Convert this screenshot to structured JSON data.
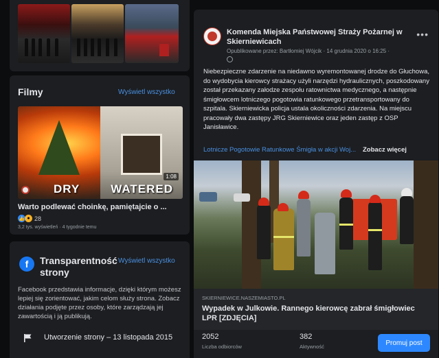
{
  "films": {
    "title": "Filmy",
    "see_all": "Wyświetl wszystko",
    "video": {
      "thumb_left_label": "DRY",
      "thumb_right_label": "WATERED",
      "duration": "1:08",
      "title": "Warto podlewać choinkę, pamiętajcie o ...",
      "reaction_count": "28",
      "meta": "3,2 tys. wyświetleń · 4 tygodnie temu"
    }
  },
  "transparency": {
    "title": "Transparentność strony",
    "see_all": "Wyświetl wszystko",
    "description": "Facebook przedstawia informacje, dzięki którym możesz lepiej się zorientować, jakim celom służy strona. Zobacz działania podjęte przez osoby, które zarządzają jej zawartością i ją publikują.",
    "created": "Utworzenie strony – 13 listopada 2015",
    "icon": "facebook-icon"
  },
  "post": {
    "page_name": "Komenda Miejska Państwowej Straży Pożarnej w Skierniewicach",
    "meta": "Opublikowane przez: Bartłomiej Wójcik · 14 grudnia 2020 o 16:25 ·",
    "text": "Niebezpieczne zdarzenie na niedawno wyremontowanej drodze do Głuchowa, do wydobycia kierowcy strażacy użyli narzędzi hydraulicznych, poszkodowany został przekazany załodze zespołu ratownictwa medycznego, a następnie śmigłowcem lotniczego pogotowia ratunkowego przetransportowany do szpitala. Skierniewicka policja ustala okoliczności zdarzenia. Na miejscu pracowały dwa zastępy JRG Skierniewice oraz jeden zastęp z OSP Janisławice.",
    "hashtags": "Lotnicze Pogotowie Ratunkowe Śmigła w akcji Woj...",
    "see_more": "Zobacz więcej",
    "link": {
      "domain": "SKIERNIEWICE.NASZEMIASTO.PL",
      "title": "Wypadek w Julkowie. Rannego kierowcę zabrał śmigłowiec LPR [ZDJĘCIA]"
    },
    "stats": {
      "reach_value": "2052",
      "reach_label": "Liczba odbiorców",
      "engagement_value": "382",
      "engagement_label": "Aktywność"
    },
    "promote_label": "Promuj post"
  },
  "colors": {
    "accent": "#2d88ff",
    "link": "#4a90e2",
    "card": "#1c1e21",
    "background": "#0c0d0f"
  }
}
